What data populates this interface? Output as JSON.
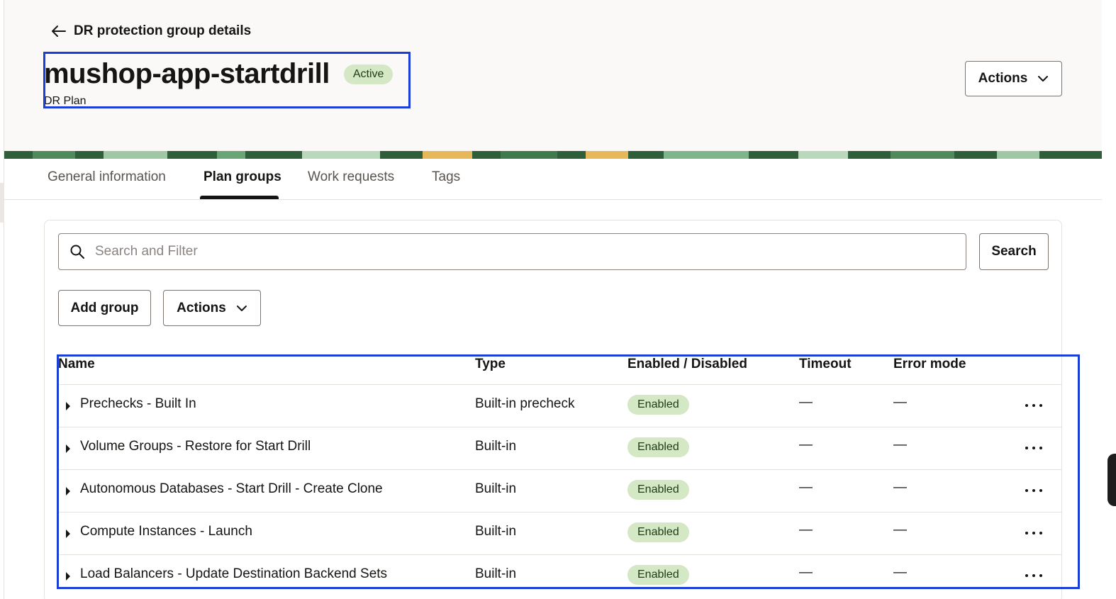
{
  "header": {
    "back_label": "DR protection group details",
    "title": "mushop-app-startdrill",
    "status": "Active",
    "subtitle": "DR Plan",
    "actions_label": "Actions"
  },
  "tabs": [
    {
      "label": "General information",
      "active": false
    },
    {
      "label": "Plan groups",
      "active": true
    },
    {
      "label": "Work requests",
      "active": false
    },
    {
      "label": "Tags",
      "active": false
    }
  ],
  "search": {
    "placeholder": "Search and Filter",
    "value": "",
    "button_label": "Search"
  },
  "toolbar": {
    "add_group_label": "Add group",
    "actions_label": "Actions"
  },
  "table": {
    "columns": [
      "Name",
      "Type",
      "Enabled / Disabled",
      "Timeout",
      "Error mode"
    ],
    "rows": [
      {
        "name": "Prechecks - Built In",
        "type": "Built-in precheck",
        "state": "Enabled",
        "timeout": "—",
        "error_mode": "—"
      },
      {
        "name": "Volume Groups - Restore for Start Drill",
        "type": "Built-in",
        "state": "Enabled",
        "timeout": "—",
        "error_mode": "—"
      },
      {
        "name": "Autonomous Databases - Start Drill - Create Clone",
        "type": "Built-in",
        "state": "Enabled",
        "timeout": "—",
        "error_mode": "—"
      },
      {
        "name": "Compute Instances - Launch",
        "type": "Built-in",
        "state": "Enabled",
        "timeout": "—",
        "error_mode": "—"
      },
      {
        "name": "Load Balancers - Update Destination Backend Sets",
        "type": "Built-in",
        "state": "Enabled",
        "timeout": "—",
        "error_mode": "—"
      }
    ]
  },
  "colors": {
    "badge_bg": "#d4e8c6",
    "highlight": "#1a3fd6",
    "header_bg": "#fbf9f8"
  }
}
